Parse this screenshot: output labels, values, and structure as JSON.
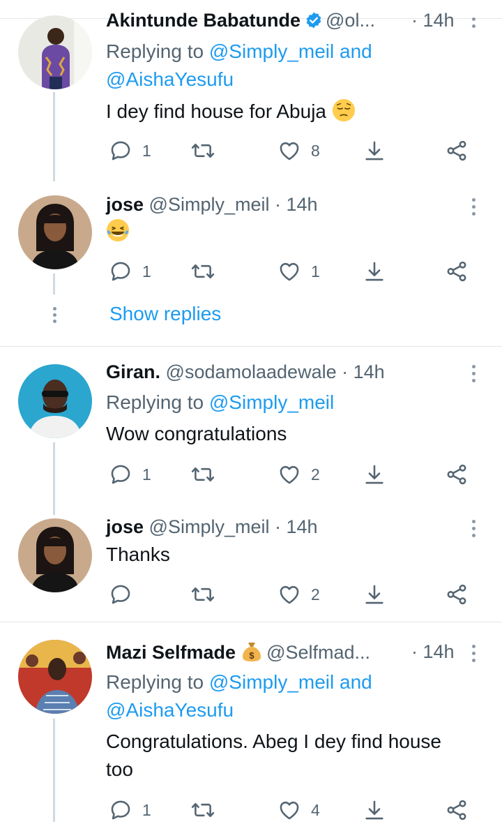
{
  "colors": {
    "link": "#1d9bf0",
    "secondary": "#536471",
    "text": "#0f1419",
    "thread_line": "#cfd9de"
  },
  "tweets": [
    {
      "name": "Akintunde Babatunde",
      "handle": "@ol...",
      "time": "· 14h",
      "verified": true,
      "replying_prefix": "Replying to ",
      "mention1": "@Simply_meil",
      "replying_and": " and",
      "mention2": "@AishaYesufu",
      "text": "I dey find house for Abuja",
      "emoji": "pensive-face",
      "replies": "1",
      "retweets": "",
      "likes": "8"
    },
    {
      "name": "jose",
      "handle": "@Simply_meil · 14h",
      "emoji": "tears-of-joy-face",
      "replies": "1",
      "retweets": "",
      "likes": "1"
    },
    {
      "name": "Giran.",
      "handle": "@sodamolaadewale · 14h",
      "replying_prefix": "Replying to ",
      "mention1": "@Simply_meil",
      "text": "Wow congratulations",
      "replies": "1",
      "retweets": "",
      "likes": "2"
    },
    {
      "name": "jose",
      "handle": "@Simply_meil · 14h",
      "text": "Thanks",
      "replies": "",
      "retweets": "",
      "likes": "2"
    },
    {
      "name": "Mazi Selfmade",
      "handle": "@Selfmad...",
      "time": "· 14h",
      "badge_emoji": "money-bag",
      "replying_prefix": "Replying to ",
      "mention1": "@Simply_meil",
      "replying_and": " and",
      "mention2": "@AishaYesufu",
      "text_line1": "Congratulations. Abeg I dey find house",
      "text_line2": "too",
      "replies": "1",
      "retweets": "",
      "likes": "4"
    }
  ],
  "show_replies": "Show replies",
  "icons": [
    "reply-icon",
    "retweet-icon",
    "like-icon",
    "download-icon",
    "share-icon",
    "more-icon",
    "verified-icon"
  ]
}
